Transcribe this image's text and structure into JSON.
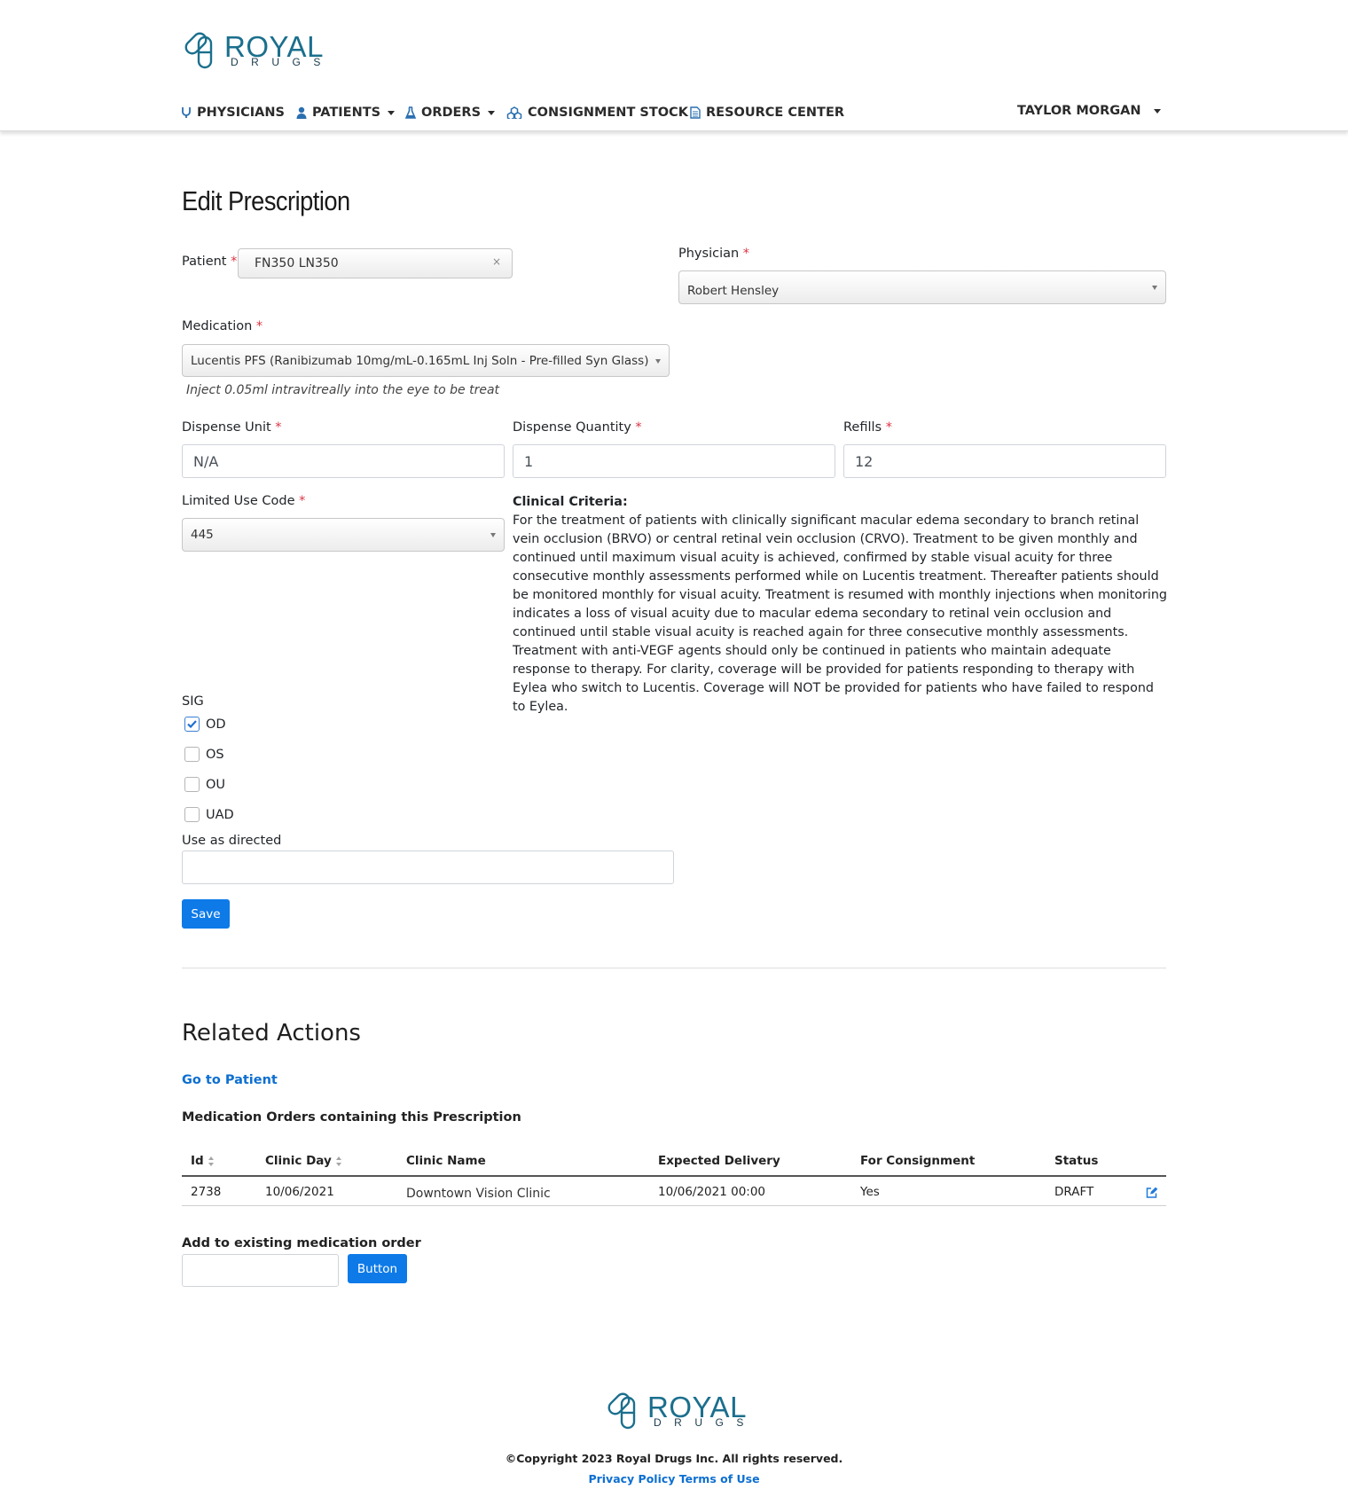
{
  "brand": {
    "name_top": "ROYAL",
    "name_bottom": "DRUGS"
  },
  "nav": {
    "items": [
      {
        "label": "PHYSICIANS",
        "icon": "stethoscope-icon",
        "dropdown": false
      },
      {
        "label": "PATIENTS",
        "icon": "user-icon",
        "dropdown": true
      },
      {
        "label": "ORDERS",
        "icon": "flask-icon",
        "dropdown": true
      },
      {
        "label": "CONSIGNMENT STOCK",
        "icon": "cubes-icon",
        "dropdown": false
      },
      {
        "label": "RESOURCE CENTER",
        "icon": "document-icon",
        "dropdown": false
      }
    ],
    "user": "TAYLOR MORGAN"
  },
  "form": {
    "title": "Edit Prescription",
    "patient": {
      "label": "Patient",
      "value": "FN350 LN350",
      "clear": "×"
    },
    "physician": {
      "label": "Physician",
      "value": "Robert Hensley"
    },
    "medication": {
      "label": "Medication",
      "value": "Lucentis PFS (Ranibizumab 10mg/mL-0.165mL Inj Soln - Pre-filled Syn Glass)",
      "help": "Inject 0.05ml intravitreally into the eye to be treat"
    },
    "dispense_unit": {
      "label": "Dispense Unit",
      "value": "N/A"
    },
    "dispense_quantity": {
      "label": "Dispense Quantity",
      "value": "1"
    },
    "refills": {
      "label": "Refills",
      "value": "12"
    },
    "limited_use_code": {
      "label": "Limited Use Code",
      "value": "445"
    },
    "required_mark": "*",
    "clinical_criteria": {
      "title": "Clinical Criteria:",
      "text": "For the treatment of patients with clinically significant macular edema secondary to branch retinal vein occlusion (BRVO) or central retinal vein occlusion (CRVO). Treatment to be given monthly and continued until maximum visual acuity is achieved, confirmed by stable visual acuity for three consecutive monthly assessments performed while on Lucentis treatment. Thereafter patients should be monitored monthly for visual acuity. Treatment is resumed with monthly injections when monitoring indicates a loss of visual acuity due to macular edema secondary to retinal vein occlusion and continued until stable visual acuity is reached again for three consecutive monthly assessments. Treatment with anti-VEGF agents should only be continued in patients who maintain adequate response to therapy. For clarity, coverage will be provided for patients responding to therapy with Eylea who switch to Lucentis. Coverage will NOT be provided for patients who have failed to respond to Eylea."
    },
    "sig": {
      "label": "SIG",
      "options": [
        {
          "label": "OD",
          "checked": true
        },
        {
          "label": "OS",
          "checked": false
        },
        {
          "label": "OU",
          "checked": false
        },
        {
          "label": "UAD",
          "checked": false
        }
      ]
    },
    "use_as_directed": {
      "label": "Use as directed",
      "value": ""
    },
    "save_label": "Save"
  },
  "related": {
    "title": "Related Actions",
    "go_to_patient": "Go to Patient",
    "orders_heading": "Medication Orders containing this Prescription",
    "columns": [
      "Id",
      "Clinic Day",
      "Clinic Name",
      "Expected Delivery",
      "For Consignment",
      "Status"
    ],
    "rows": [
      {
        "id": "2738",
        "clinic_day": "10/06/2021",
        "clinic_name": "Downtown Vision Clinic",
        "expected_delivery": "10/06/2021 00:00",
        "for_consignment": "Yes",
        "status": "DRAFT"
      }
    ],
    "add_heading": "Add to existing medication order",
    "add_value": "",
    "add_button": "Button"
  },
  "footer": {
    "copyright": "©Copyright 2023 Royal Drugs Inc. All rights reserved.",
    "privacy": "Privacy Policy",
    "terms": "Terms of Use"
  },
  "colors": {
    "brand": "#1b6f8d",
    "primary": "#0d7ae8",
    "link": "#0d6fd1",
    "required": "#dc3545"
  }
}
